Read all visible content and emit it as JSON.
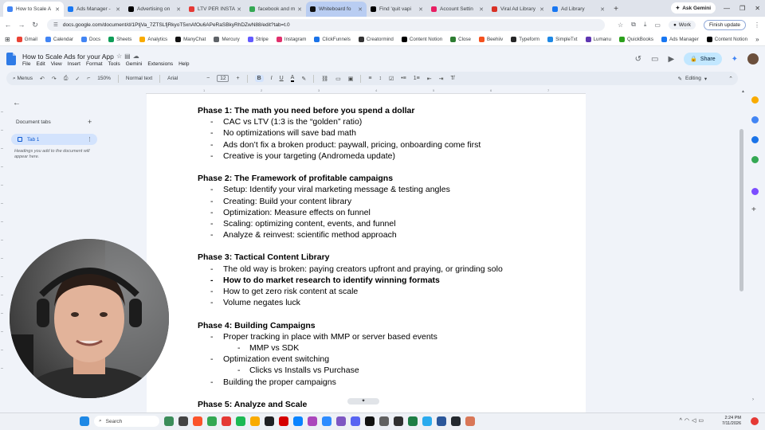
{
  "tabs": [
    {
      "title": "How to Scale A",
      "color": "#4285f4",
      "state": "active"
    },
    {
      "title": "Ads Manager -",
      "color": "#1877f2",
      "state": ""
    },
    {
      "title": "Advertising on",
      "color": "#000000",
      "state": ""
    },
    {
      "title": "LTV PER INSTAL",
      "color": "#e53935",
      "state": ""
    },
    {
      "title": "facebook and m",
      "color": "#34a853",
      "state": ""
    },
    {
      "title": "Whiteboard fo",
      "color": "#111111",
      "state": "hl"
    },
    {
      "title": "Find 'quit vapi",
      "color": "#000000",
      "state": ""
    },
    {
      "title": "Account Settin",
      "color": "#e91e63",
      "state": ""
    },
    {
      "title": "Viral Ad Library",
      "color": "#d93025",
      "state": ""
    },
    {
      "title": "Ad Library",
      "color": "#1877f2",
      "state": ""
    }
  ],
  "browser": {
    "new_tab": "+",
    "ask_gemini": "Ask Gemini",
    "url": "docs.google.com/document/d/1PtjVa_7ZTSLfjRkyoT5xnAfOu6APeRaSBkyRhDZwN88/edit?tab=t.0",
    "work_label": "Work",
    "finish_update": "Finish update"
  },
  "bookmarks": [
    {
      "label": "Gmail",
      "color": "#ea4335"
    },
    {
      "label": "Calendar",
      "color": "#4285f4"
    },
    {
      "label": "Docs",
      "color": "#4285f4"
    },
    {
      "label": "Sheets",
      "color": "#0f9d58"
    },
    {
      "label": "Analytics",
      "color": "#f9ab00"
    },
    {
      "label": "ManyChat",
      "color": "#111111"
    },
    {
      "label": "Mercury",
      "color": "#5f6368"
    },
    {
      "label": "Stripe",
      "color": "#635bff"
    },
    {
      "label": "Instagram",
      "color": "#e1306c"
    },
    {
      "label": "ClickFunnels",
      "color": "#1a73e8"
    },
    {
      "label": "Creatormind",
      "color": "#333333"
    },
    {
      "label": "Content Notion",
      "color": "#000000"
    },
    {
      "label": "Close",
      "color": "#2e7d32"
    },
    {
      "label": "Beehiiv",
      "color": "#f4511e"
    },
    {
      "label": "Typeform",
      "color": "#262627"
    },
    {
      "label": "SimpleTxt",
      "color": "#1e88e5"
    },
    {
      "label": "Lumanu",
      "color": "#5e35b1"
    },
    {
      "label": "QuickBooks",
      "color": "#2ca01c"
    },
    {
      "label": "Ads Manager",
      "color": "#1877f2"
    },
    {
      "label": "Content Notion",
      "color": "#000000"
    }
  ],
  "doc": {
    "title": "How to Scale Ads for your App",
    "menus": [
      "File",
      "Edit",
      "View",
      "Insert",
      "Format",
      "Tools",
      "Gemini",
      "Extensions",
      "Help"
    ],
    "share": "Share"
  },
  "toolbar": {
    "menus": "Menus",
    "zoom": "150%",
    "style": "Normal text",
    "font": "Arial",
    "font_size": "12",
    "bold": "B",
    "italic": "I",
    "underline": "U",
    "text_color": "A",
    "editing": "Editing"
  },
  "sidebar": {
    "title": "Document tabs",
    "tab1": "Tab 1",
    "hint": "Headings you add to the document will appear here."
  },
  "document": [
    {
      "kind": "ph",
      "text": "Phase 1: The math you need before you spend a dollar"
    },
    {
      "kind": "bl",
      "text": "CAC vs LTV (1:3 is the “golden” ratio)"
    },
    {
      "kind": "bl",
      "text": "No optimizations will save bad math"
    },
    {
      "kind": "bl",
      "text": "Ads don’t fix a broken product: paywall, pricing, onboarding come first"
    },
    {
      "kind": "bl",
      "text": "Creative is your targeting (Andromeda update)"
    },
    {
      "kind": "gap",
      "text": ""
    },
    {
      "kind": "ph",
      "text": "Phase 2: The Framework of profitable campaigns"
    },
    {
      "kind": "bl",
      "text": "Setup: Identify your viral marketing message & testing angles"
    },
    {
      "kind": "bl",
      "text": "Creating: Build your content library"
    },
    {
      "kind": "bl",
      "text": "Optimization: Measure effects on funnel"
    },
    {
      "kind": "bl",
      "text": "Scaling: optimizing content, events, and funnel"
    },
    {
      "kind": "bl",
      "text": "Analyze & reinvest: scientific method approach"
    },
    {
      "kind": "gap",
      "text": ""
    },
    {
      "kind": "ph",
      "text": "Phase 3: Tactical Content Library"
    },
    {
      "kind": "bl",
      "text": "The old way is broken: paying creators upfront and praying, or grinding solo"
    },
    {
      "kind": "bl b",
      "text": "How to do market research to identify winning formats"
    },
    {
      "kind": "bl",
      "text": "How to get zero risk content at scale"
    },
    {
      "kind": "bl",
      "text": "Volume negates luck"
    },
    {
      "kind": "gap",
      "text": ""
    },
    {
      "kind": "ph",
      "text": "Phase 4: Building Campaigns"
    },
    {
      "kind": "bl",
      "text": "Proper tracking in place with MMP or server based events"
    },
    {
      "kind": "bl l2",
      "text": "MMP vs SDK"
    },
    {
      "kind": "bl",
      "text": "Optimization event switching"
    },
    {
      "kind": "bl l2",
      "text": "Clicks vs Installs vs Purchase"
    },
    {
      "kind": "bl",
      "text": "Building the proper campaigns"
    },
    {
      "kind": "gap",
      "text": ""
    },
    {
      "kind": "ph",
      "text": "Phase 5: Analyze and Scale"
    }
  ],
  "taskbar": {
    "search": "Search",
    "time": "2:24 PM",
    "date": "7/11/2026"
  }
}
